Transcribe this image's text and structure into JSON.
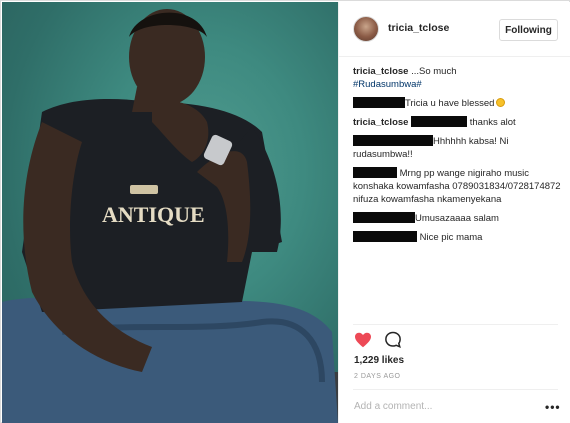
{
  "post": {
    "username": "tricia_tclose",
    "follow_label": "Following",
    "likes": "1,229 likes",
    "time_ago": "2 DAYS AGO",
    "add_comment_placeholder": "Add a comment...",
    "more_label": "•••",
    "photo_shirt_text": "ANTIQUE"
  },
  "comments": [
    {
      "author": "tricia_tclose",
      "text": " ...So much",
      "hashtag": "#Rudasumbwa#"
    },
    {
      "text": "Tricia u have blessed",
      "emoji": "grinning-face-emoji"
    },
    {
      "author": "tricia_tclose",
      "text": " thanks alot"
    },
    {
      "text": "Hhhhhh kabsa! Ni rudasumbwa!!"
    },
    {
      "text": "Mrng pp wange nigiraho music konshaka kowamfasha 0789031834/0728174872 nifuza kowamfasha nkamenyekana"
    },
    {
      "text": "Umusazaaaa salam"
    },
    {
      "text": "Nice pic mama"
    }
  ],
  "icons": {
    "heart": "heart-icon",
    "comment": "comment-icon",
    "avatar": "avatar"
  },
  "colors": {
    "heart": "#ed4956",
    "hashtag": "#003569",
    "background_photo": "#3e8a80"
  }
}
